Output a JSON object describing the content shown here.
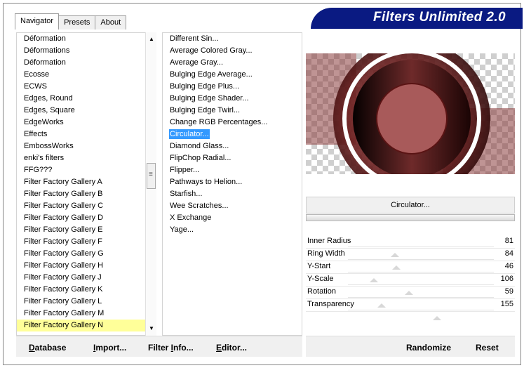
{
  "tabs": [
    "Navigator",
    "Presets",
    "About"
  ],
  "app_title": "Filters Unlimited 2.0",
  "categories": [
    "Déformation",
    "Déformations",
    "Déformation",
    "Ecosse",
    "ECWS",
    "Edges, Round",
    "Edges, Square",
    "EdgeWorks",
    "Effects",
    "EmbossWorks",
    "enki's filters",
    "FFG???",
    "Filter Factory Gallery A",
    "Filter Factory Gallery B",
    "Filter Factory Gallery C",
    "Filter Factory Gallery D",
    "Filter Factory Gallery E",
    "Filter Factory Gallery F",
    "Filter Factory Gallery G",
    "Filter Factory Gallery H",
    "Filter Factory Gallery J",
    "Filter Factory Gallery K",
    "Filter Factory Gallery L",
    "Filter Factory Gallery M",
    "Filter Factory Gallery N"
  ],
  "highlighted_category": "Filter Factory Gallery N",
  "filters": [
    "Different Sin...",
    "Average Colored Gray...",
    "Average Gray...",
    "Bulging Edge Average...",
    "Bulging Edge Plus...",
    "Bulging Edge Shader...",
    "Bulging Edge Twirl...",
    "Change RGB Percentages...",
    "Circulator...",
    "Diamond Glass...",
    "FlipChop Radial...",
    "Flipper...",
    "Pathways to Helion...",
    "Starfish...",
    "Wee Scratches...",
    "X Exchange",
    "Yage..."
  ],
  "selected_filter": "Circulator...",
  "current_filter_label": "Circulator...",
  "sliders": [
    {
      "name": "Inner Radius",
      "value": "81",
      "level": 0.32
    },
    {
      "name": "Ring Width",
      "value": "84",
      "level": 0.33
    },
    {
      "name": "Y-Start",
      "value": "46",
      "level": 0.18
    },
    {
      "name": "Y-Scale",
      "value": "106",
      "level": 0.42
    },
    {
      "name": "Rotation",
      "value": "59",
      "level": 0.23
    },
    {
      "name": "Transparency",
      "value": "155",
      "level": 0.61
    }
  ],
  "buttons": {
    "database": {
      "pre": "",
      "u": "D",
      "post": "atabase"
    },
    "import": {
      "pre": "",
      "u": "I",
      "post": "mport..."
    },
    "filter_info": {
      "pre": "Filter ",
      "u": "I",
      "post": "nfo..."
    },
    "editor": {
      "pre": "",
      "u": "E",
      "post": "ditor..."
    },
    "randomize": {
      "pre": "Randomize",
      "u": "",
      "post": ""
    },
    "reset": {
      "pre": "Reset",
      "u": "",
      "post": ""
    }
  },
  "colors": {
    "banner": "#0a1a82",
    "selection": "#3399ff",
    "highlight": "#ffff99"
  }
}
